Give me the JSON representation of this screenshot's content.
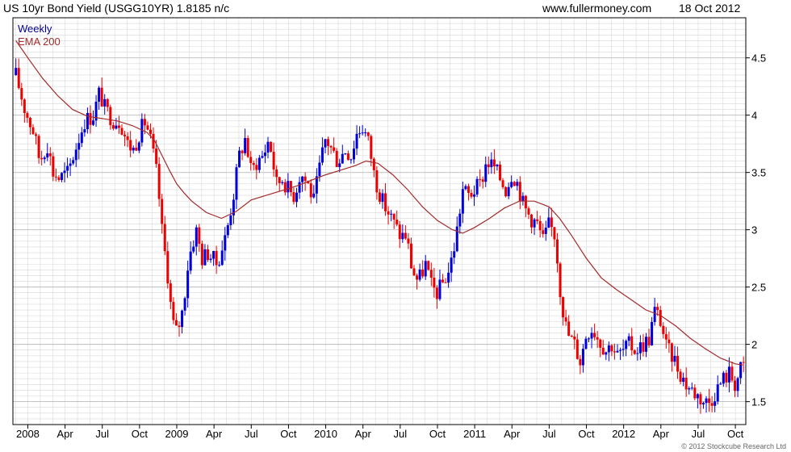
{
  "header": {
    "title": "US 10yr Bond Yield (USGG10YR) 1.8185 n/c",
    "website": "www.fullermoney.com",
    "date": "18 Oct 2012"
  },
  "footer": {
    "copyright": "© 2012 Stockcube Research Ltd"
  },
  "colors": {
    "up": "#0000dd",
    "down": "#ee0000",
    "ema": "#a52a2a",
    "grid": "#d8d8d8",
    "legend_weekly": "#00008b",
    "legend_ema": "#a52a2a"
  },
  "chart_data": {
    "type": "candlestick",
    "legend": [
      {
        "label": "Weekly",
        "color": "#00008b"
      },
      {
        "label": "EMA 200",
        "color": "#a52a2a"
      }
    ],
    "y_ticks": [
      "1.5",
      "2",
      "2.5",
      "3",
      "3.5",
      "4",
      "4.5"
    ],
    "ylim": [
      1.3,
      4.85
    ],
    "x_ticks": [
      {
        "label": "2008",
        "t": 2008.0
      },
      {
        "label": "Apr",
        "t": 2008.25
      },
      {
        "label": "Jul",
        "t": 2008.5
      },
      {
        "label": "Oct",
        "t": 2008.75
      },
      {
        "label": "2009",
        "t": 2009.0
      },
      {
        "label": "Apr",
        "t": 2009.25
      },
      {
        "label": "Jul",
        "t": 2009.5
      },
      {
        "label": "Oct",
        "t": 2009.75
      },
      {
        "label": "2010",
        "t": 2010.0
      },
      {
        "label": "Apr",
        "t": 2010.25
      },
      {
        "label": "Jul",
        "t": 2010.5
      },
      {
        "label": "Oct",
        "t": 2010.75
      },
      {
        "label": "2011",
        "t": 2011.0
      },
      {
        "label": "Apr",
        "t": 2011.25
      },
      {
        "label": "Jul",
        "t": 2011.5
      },
      {
        "label": "Oct",
        "t": 2011.75
      },
      {
        "label": "2012",
        "t": 2012.0
      },
      {
        "label": "Apr",
        "t": 2012.25
      },
      {
        "label": "Jul",
        "t": 2012.5
      },
      {
        "label": "Oct",
        "t": 2012.75
      }
    ],
    "x_range": [
      2007.9,
      2012.82
    ],
    "close_path": [
      [
        2007.92,
        4.35
      ],
      [
        2007.98,
        4.05
      ],
      [
        2008.04,
        3.85
      ],
      [
        2008.08,
        3.6
      ],
      [
        2008.13,
        3.75
      ],
      [
        2008.17,
        3.5
      ],
      [
        2008.21,
        3.45
      ],
      [
        2008.27,
        3.5
      ],
      [
        2008.33,
        3.75
      ],
      [
        2008.38,
        3.95
      ],
      [
        2008.44,
        4.0
      ],
      [
        2008.48,
        4.2
      ],
      [
        2008.52,
        4.05
      ],
      [
        2008.58,
        3.95
      ],
      [
        2008.62,
        3.95
      ],
      [
        2008.67,
        3.75
      ],
      [
        2008.71,
        3.7
      ],
      [
        2008.75,
        3.85
      ],
      [
        2008.79,
        3.95
      ],
      [
        2008.83,
        3.75
      ],
      [
        2008.87,
        3.45
      ],
      [
        2008.9,
        3.0
      ],
      [
        2008.94,
        2.6
      ],
      [
        2008.97,
        2.2
      ],
      [
        2009.0,
        2.1
      ],
      [
        2009.04,
        2.3
      ],
      [
        2009.08,
        2.75
      ],
      [
        2009.13,
        3.0
      ],
      [
        2009.17,
        2.75
      ],
      [
        2009.21,
        2.8
      ],
      [
        2009.27,
        2.7
      ],
      [
        2009.33,
        2.95
      ],
      [
        2009.38,
        3.3
      ],
      [
        2009.42,
        3.65
      ],
      [
        2009.46,
        3.8
      ],
      [
        2009.5,
        3.5
      ],
      [
        2009.54,
        3.6
      ],
      [
        2009.58,
        3.65
      ],
      [
        2009.62,
        3.8
      ],
      [
        2009.67,
        3.4
      ],
      [
        2009.71,
        3.45
      ],
      [
        2009.75,
        3.35
      ],
      [
        2009.79,
        3.3
      ],
      [
        2009.83,
        3.5
      ],
      [
        2009.88,
        3.4
      ],
      [
        2009.92,
        3.25
      ],
      [
        2009.96,
        3.55
      ],
      [
        2010.0,
        3.8
      ],
      [
        2010.04,
        3.7
      ],
      [
        2010.08,
        3.6
      ],
      [
        2010.13,
        3.7
      ],
      [
        2010.17,
        3.65
      ],
      [
        2010.21,
        3.85
      ],
      [
        2010.25,
        3.9
      ],
      [
        2010.29,
        3.75
      ],
      [
        2010.33,
        3.45
      ],
      [
        2010.38,
        3.25
      ],
      [
        2010.42,
        3.15
      ],
      [
        2010.46,
        3.05
      ],
      [
        2010.5,
        2.95
      ],
      [
        2010.54,
        2.95
      ],
      [
        2010.58,
        2.65
      ],
      [
        2010.62,
        2.55
      ],
      [
        2010.67,
        2.7
      ],
      [
        2010.71,
        2.5
      ],
      [
        2010.75,
        2.45
      ],
      [
        2010.79,
        2.55
      ],
      [
        2010.83,
        2.65
      ],
      [
        2010.87,
        2.9
      ],
      [
        2010.92,
        3.35
      ],
      [
        2010.96,
        3.3
      ],
      [
        2011.0,
        3.35
      ],
      [
        2011.04,
        3.4
      ],
      [
        2011.08,
        3.6
      ],
      [
        2011.13,
        3.55
      ],
      [
        2011.17,
        3.45
      ],
      [
        2011.21,
        3.35
      ],
      [
        2011.25,
        3.5
      ],
      [
        2011.29,
        3.4
      ],
      [
        2011.33,
        3.2
      ],
      [
        2011.38,
        3.1
      ],
      [
        2011.42,
        3.05
      ],
      [
        2011.46,
        2.9
      ],
      [
        2011.5,
        3.05
      ],
      [
        2011.54,
        2.95
      ],
      [
        2011.58,
        2.4
      ],
      [
        2011.62,
        2.1
      ],
      [
        2011.67,
        2.0
      ],
      [
        2011.71,
        1.85
      ],
      [
        2011.75,
        2.1
      ],
      [
        2011.79,
        2.15
      ],
      [
        2011.83,
        2.05
      ],
      [
        2011.88,
        1.95
      ],
      [
        2011.92,
        2.0
      ],
      [
        2011.96,
        1.9
      ],
      [
        2012.0,
        1.95
      ],
      [
        2012.04,
        2.0
      ],
      [
        2012.08,
        1.95
      ],
      [
        2012.13,
        2.0
      ],
      [
        2012.17,
        2.05
      ],
      [
        2012.21,
        2.3
      ],
      [
        2012.25,
        2.2
      ],
      [
        2012.29,
        1.95
      ],
      [
        2012.33,
        1.9
      ],
      [
        2012.38,
        1.75
      ],
      [
        2012.42,
        1.65
      ],
      [
        2012.46,
        1.6
      ],
      [
        2012.5,
        1.55
      ],
      [
        2012.54,
        1.5
      ],
      [
        2012.58,
        1.5
      ],
      [
        2012.62,
        1.6
      ],
      [
        2012.67,
        1.7
      ],
      [
        2012.71,
        1.75
      ],
      [
        2012.75,
        1.65
      ],
      [
        2012.79,
        1.8
      ]
    ],
    "ema_path": [
      [
        2007.92,
        4.65
      ],
      [
        2008.0,
        4.5
      ],
      [
        2008.1,
        4.32
      ],
      [
        2008.2,
        4.17
      ],
      [
        2008.3,
        4.05
      ],
      [
        2008.4,
        3.99
      ],
      [
        2008.5,
        3.97
      ],
      [
        2008.6,
        3.95
      ],
      [
        2008.7,
        3.91
      ],
      [
        2008.8,
        3.85
      ],
      [
        2008.85,
        3.78
      ],
      [
        2008.9,
        3.65
      ],
      [
        2008.95,
        3.52
      ],
      [
        2009.0,
        3.4
      ],
      [
        2009.05,
        3.32
      ],
      [
        2009.1,
        3.25
      ],
      [
        2009.2,
        3.15
      ],
      [
        2009.3,
        3.1
      ],
      [
        2009.4,
        3.16
      ],
      [
        2009.5,
        3.26
      ],
      [
        2009.6,
        3.3
      ],
      [
        2009.7,
        3.34
      ],
      [
        2009.8,
        3.38
      ],
      [
        2009.9,
        3.43
      ],
      [
        2010.0,
        3.48
      ],
      [
        2010.1,
        3.52
      ],
      [
        2010.2,
        3.56
      ],
      [
        2010.27,
        3.6
      ],
      [
        2010.35,
        3.58
      ],
      [
        2010.45,
        3.48
      ],
      [
        2010.55,
        3.35
      ],
      [
        2010.65,
        3.2
      ],
      [
        2010.75,
        3.08
      ],
      [
        2010.85,
        3.0
      ],
      [
        2010.92,
        2.97
      ],
      [
        2011.0,
        3.02
      ],
      [
        2011.1,
        3.1
      ],
      [
        2011.2,
        3.19
      ],
      [
        2011.3,
        3.25
      ],
      [
        2011.4,
        3.25
      ],
      [
        2011.5,
        3.2
      ],
      [
        2011.57,
        3.1
      ],
      [
        2011.65,
        2.95
      ],
      [
        2011.75,
        2.75
      ],
      [
        2011.85,
        2.58
      ],
      [
        2011.95,
        2.48
      ],
      [
        2012.05,
        2.39
      ],
      [
        2012.15,
        2.3
      ],
      [
        2012.25,
        2.25
      ],
      [
        2012.35,
        2.16
      ],
      [
        2012.45,
        2.05
      ],
      [
        2012.55,
        1.96
      ],
      [
        2012.65,
        1.88
      ],
      [
        2012.75,
        1.83
      ],
      [
        2012.8,
        1.82
      ]
    ]
  }
}
